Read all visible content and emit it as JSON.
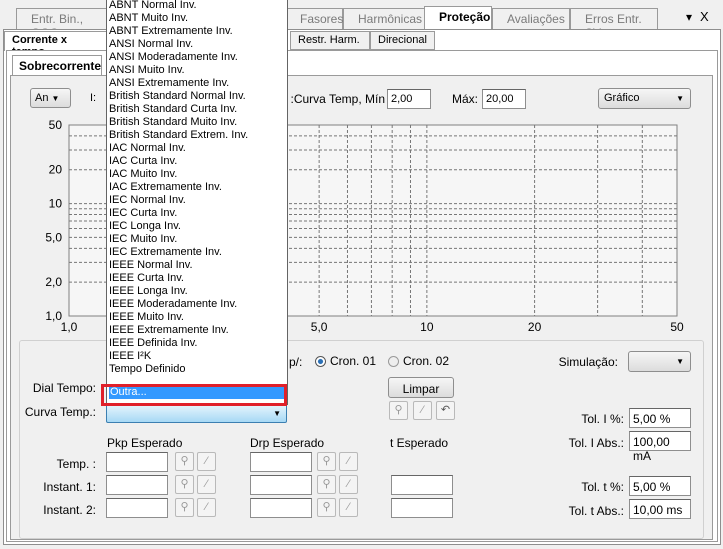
{
  "top_tabs": [
    {
      "label": "Entr. Bin., GOC",
      "active": false
    },
    {
      "label": "Fasores",
      "active": false
    },
    {
      "label": "Harmônicas",
      "active": false
    },
    {
      "label": "Proteção",
      "active": true
    },
    {
      "label": "Avaliações",
      "active": false
    },
    {
      "label": "Erros Entr. SV",
      "active": false
    }
  ],
  "window_controls": {
    "menu": "▾",
    "close": "X"
  },
  "sub_tabs": [
    "Corrente x tempo",
    "Restr. Harm.",
    "Direcional"
  ],
  "inner_tab": "Sobrecorrente",
  "toolbar": {
    "mode_select": "An",
    "i_label": "I:",
    "curve_min_label": "Curva Temp, Mín:",
    "curve_min_value": "2,00",
    "max_label": "Máx:",
    "max_value": "20,00",
    "view_select": "Gráfico"
  },
  "chart_data": {
    "type": "line",
    "xscale": "log",
    "yscale": "log",
    "xlim": [
      1,
      50
    ],
    "ylim": [
      1,
      50
    ],
    "grid": true,
    "x_ticks": [
      "1,0",
      "5,0",
      "10",
      "20",
      "50"
    ],
    "y_ticks": [
      "50",
      "20",
      "10",
      "5,0",
      "2,0",
      "1,0"
    ],
    "x_tick_values": [
      1,
      5,
      10,
      20,
      50
    ],
    "y_tick_values": [
      50,
      20,
      10,
      5,
      2,
      1
    ],
    "series": []
  },
  "dropdown": {
    "items": [
      "ABNT Normal Inv.",
      "ABNT Muito Inv.",
      "ABNT Extremamente Inv.",
      "ANSI Normal Inv.",
      "ANSI Moderadamente Inv.",
      "ANSI Muito Inv.",
      "ANSI Extremamente Inv.",
      "British Standard Normal Inv.",
      "British Standard Curta Inv.",
      "British Standard Muito Inv.",
      "British Standard Extrem. Inv.",
      "IAC Normal Inv.",
      "IAC Curta Inv.",
      "IAC Muito Inv.",
      "IAC Extremamente Inv.",
      "IEC Normal Inv.",
      "IEC Curta Inv.",
      "IEC Longa Inv.",
      "IEC Muito Inv.",
      "IEC Extremamente Inv.",
      "IEEE Normal Inv.",
      "IEEE Curta Inv.",
      "IEEE Longa Inv.",
      "IEEE Moderadamente Inv.",
      "IEEE Muito Inv.",
      "IEEE Extremamente Inv.",
      "IEEE Definida Inv.",
      "IEEE I²K",
      "Tempo Definido"
    ],
    "selected": "Outra..."
  },
  "form": {
    "temp_label_partial": "p/:",
    "cron01": "Cron. 01",
    "cron02": "Cron. 02",
    "cron_selected": "Cron. 01",
    "simulacao_label": "Simulação:",
    "simulacao_value": "",
    "dial_tempo_label": "Dial Tempo:",
    "curva_temp_label": "Curva Temp.:",
    "curva_temp_value": "",
    "limpar": "Limpar",
    "pkp_header": "Pkp Esperado",
    "drp_header": "Drp Esperado",
    "t_header": "t Esperado",
    "rows": [
      "Temp. :",
      "Instant. 1:",
      "Instant. 2:"
    ],
    "tol_i_pct_label": "Tol. I %:",
    "tol_i_pct": "5,00 %",
    "tol_i_abs_label": "Tol. I Abs.:",
    "tol_i_abs": "100,00 mA",
    "tol_t_pct_label": "Tol. t %:",
    "tol_t_pct": "5,00 %",
    "tol_t_abs_label": "Tol. t Abs.:",
    "tol_t_abs": "10,00 ms"
  }
}
